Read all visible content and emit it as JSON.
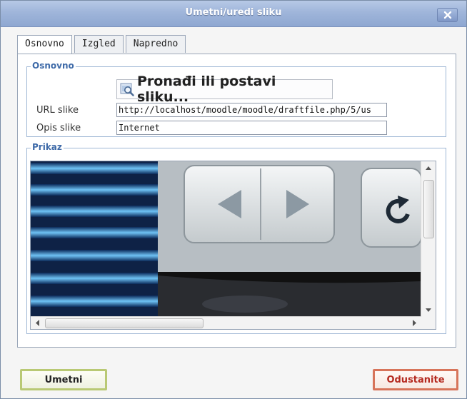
{
  "dialog": {
    "title": "Umetni/uredi sliku",
    "close_icon": "close-icon"
  },
  "tabs": [
    {
      "label": "Osnovno",
      "active": true
    },
    {
      "label": "Izgled",
      "active": false
    },
    {
      "label": "Napredno",
      "active": false
    }
  ],
  "basic_group": {
    "legend": "Osnovno",
    "find_button_label": "Pronađi ili postavi sliku...",
    "find_button_icon": "image-search-icon",
    "url_label": "URL slike",
    "url_value": "http://localhost/moodle/moodle/draftfile.php/5/us",
    "desc_label": "Opis slike",
    "desc_value": "Internet"
  },
  "preview_group": {
    "legend": "Prikaz",
    "preview_image": "browser-navigation-buttons-photo"
  },
  "footer": {
    "insert_label": "Umetni",
    "cancel_label": "Odustanite"
  },
  "colors": {
    "titlebar": "#9fb5da",
    "legend_text": "#3e6aa8",
    "insert_border": "#b9c974",
    "cancel_text": "#b52a20",
    "cancel_border": "#d7745a"
  }
}
